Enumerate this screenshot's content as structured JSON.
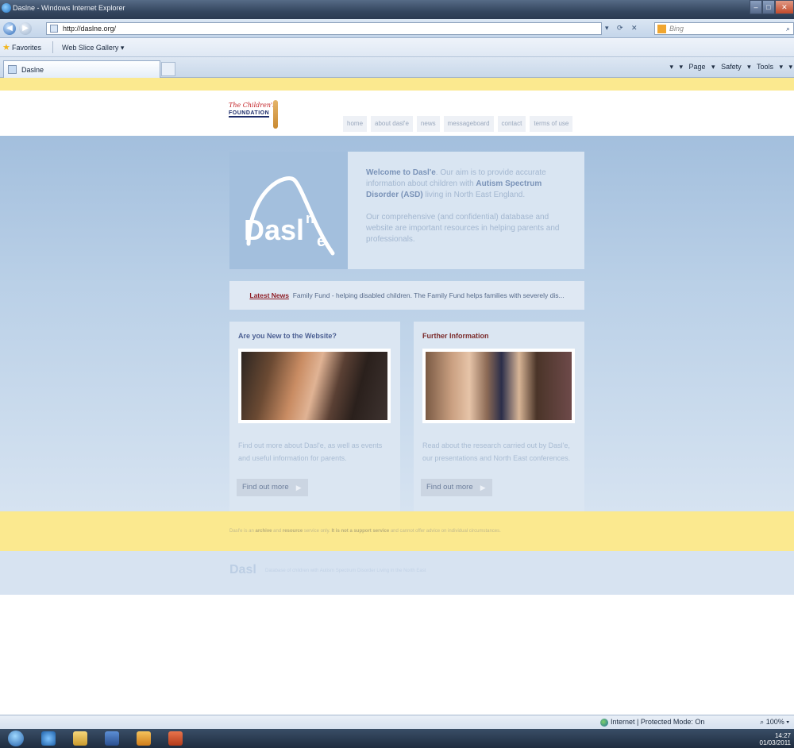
{
  "browser": {
    "window_title": "Daslne - Windows Internet Explorer",
    "address": "http://daslne.org/",
    "search_placeholder": "Bing",
    "favorites_label": "Favorites",
    "web_slice_label": "Web Slice Gallery ▾",
    "tab_label": "Daslne",
    "command_bar": "▾ ▾ Page ▾ Safety ▾ Tools ▾ ▾",
    "status_zone": "Internet | Protected Mode: On",
    "zoom_level": "100%",
    "clock_time": "14:27",
    "clock_date": "01/03/2011"
  },
  "site": {
    "logo_line1": "The Children's",
    "logo_line2": "FOUNDATION",
    "nav": [
      "home",
      "about dasl'e",
      "news",
      "messageboard",
      "contact",
      "terms of use"
    ],
    "brand_mark": "Dasl",
    "brand_sup": "n",
    "brand_sub": "e",
    "welcome": {
      "intro_bold": "Welcome to Dasl'e",
      "intro_rest": ". Our aim is to provide accurate information about children with ",
      "asd_bold": "Autism Spectrum Disorder (ASD)",
      "intro_end": " living in North East England.",
      "para2": "Our comprehensive (and confidential) database and website are important resources in helping parents and professionals."
    },
    "news": {
      "label": "Latest News",
      "text": "Family Fund - helping disabled children. The Family Fund helps families with severely dis..."
    },
    "cards": [
      {
        "title": "Are you New to the Website?",
        "desc": "Find out more about Dasl'e, as well as events and useful information for parents.",
        "button": "Find out more"
      },
      {
        "title": "Further Information",
        "desc": "Read about the research carried out by Dasl'e, our presentations and North East conferences.",
        "button": "Find out more"
      }
    ],
    "disclaimer": {
      "prefix": "Dasl'e is an ",
      "archive": "archive",
      "and": " and ",
      "resource": "resource",
      "mid": " service only. ",
      "not_support": "It is not a support service",
      "suffix": " and cannot offer advice on individual circumstances."
    },
    "footer_logo": "Dasl",
    "footer_text": "Database of children with Autism Spectrum Disorder Living in the North East"
  },
  "colors": {
    "stripe_yellow": "#fbe98f",
    "page_blue": "#a3bfdd",
    "news_label_red": "#8d1c24"
  }
}
